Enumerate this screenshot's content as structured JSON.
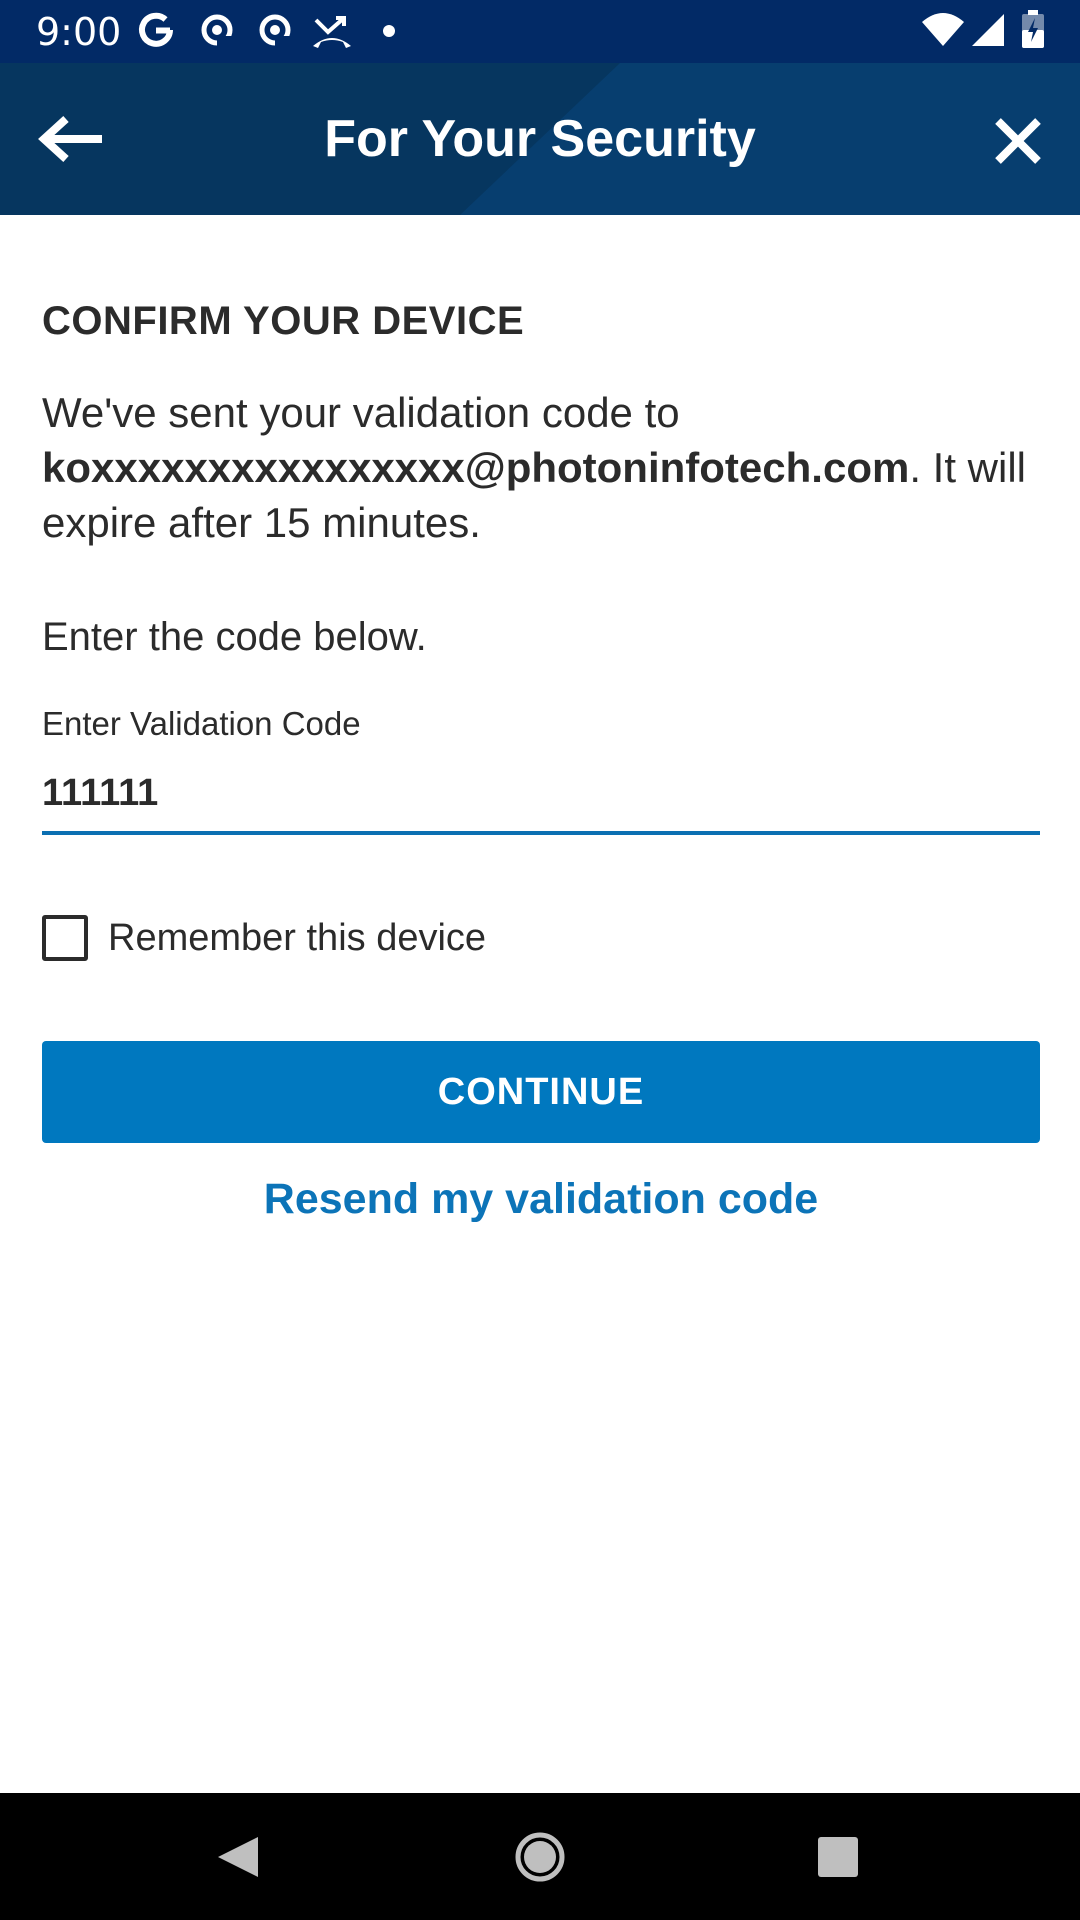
{
  "status_bar": {
    "time": "9:00",
    "icons": [
      "google-g-icon",
      "pocketcasts-icon",
      "pocketcasts-icon",
      "missed-call-icon",
      "notification-dot-icon",
      "wifi-icon",
      "signal-icon",
      "battery-icon"
    ]
  },
  "app_bar": {
    "title": "For Your Security",
    "back_icon": "arrow-left-icon",
    "close_icon": "close-icon",
    "color": "#073e6f"
  },
  "main": {
    "heading": "CONFIRM YOUR DEVICE",
    "message_prefix": "We've sent your validation code to ",
    "email": "koxxxxxxxxxxxxxxxx@photoninfotech.com",
    "message_suffix": ". It will expire after 15 minutes.",
    "instruction": "Enter the code below.",
    "code_field": {
      "label": "Enter Validation Code",
      "value": "111111"
    },
    "remember_device": {
      "label": "Remember this device",
      "checked": false
    },
    "continue_label": "CONTINUE",
    "resend_label": "Resend my validation code",
    "accent_color": "#0078bf"
  },
  "nav_bar": {
    "buttons": [
      "back-triangle-icon",
      "home-circle-icon",
      "recents-square-icon"
    ]
  }
}
